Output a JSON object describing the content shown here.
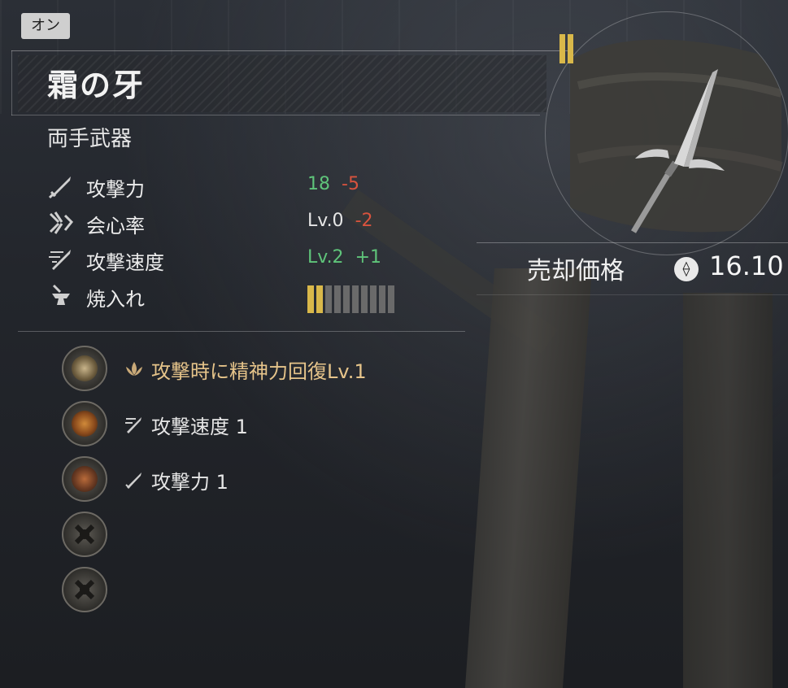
{
  "tag": {
    "label": "オン"
  },
  "item": {
    "name": "霜の牙",
    "type": "両手武器"
  },
  "stats": [
    {
      "label": "攻撃力",
      "icon": "sword-icon",
      "value": "18",
      "delta": "-5"
    },
    {
      "label": "会心率",
      "icon": "critical-icon",
      "value": "Lv.0",
      "delta": "-2"
    },
    {
      "label": "攻撃速度",
      "icon": "attack-speed-icon",
      "value": "Lv.2",
      "delta": "+1"
    },
    {
      "label": "焼入れ",
      "icon": "anvil-icon",
      "tempering": {
        "filled": 2,
        "total": 10
      }
    }
  ],
  "bonuses": [
    {
      "text": "攻撃時に精神力回復Lv.1",
      "icon": "lotus-icon",
      "color": "#e6c48a"
    },
    {
      "text": "攻撃速度 1",
      "icon": "attack-speed-icon"
    },
    {
      "text": "攻撃力 1",
      "icon": "sword-icon"
    },
    {
      "text": "",
      "icon": "empty-slot-icon"
    },
    {
      "text": "",
      "icon": "empty-slot-icon"
    }
  ],
  "sell": {
    "label": "売却価格",
    "currency_icon": "coin-icon",
    "value": "16.10"
  },
  "weapon": {
    "icon": "spear-icon",
    "rank_bars": 2
  },
  "colors": {
    "positive": "#5fc47a",
    "negative": "#d9533e",
    "gold": "#d9b84a",
    "special_text": "#e6c48a"
  }
}
